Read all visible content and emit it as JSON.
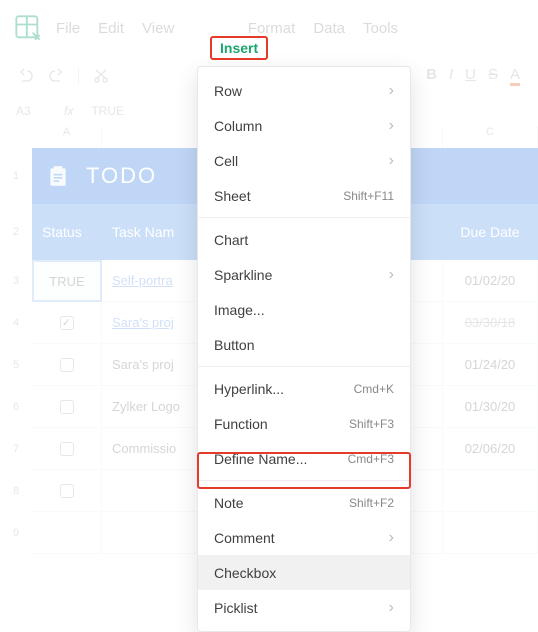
{
  "menubar": {
    "file": "File",
    "edit": "Edit",
    "view": "View",
    "insert": "Insert",
    "format": "Format",
    "data": "Data",
    "tools": "Tools"
  },
  "format_letters": {
    "bold": "B",
    "italic": "I",
    "underline": "U",
    "strike": "S",
    "color": "A"
  },
  "formula_bar": {
    "cell_ref": "A3",
    "fx_label": "fx",
    "value": "TRUE"
  },
  "col_headers": {
    "A": "A",
    "C": "C"
  },
  "rows": {
    "num1": "1",
    "num2": "2",
    "num3": "3",
    "num4": "4",
    "num5": "5",
    "num6": "6",
    "num7": "7",
    "num8": "8",
    "num9": "9"
  },
  "todo": {
    "title": "TODO",
    "header_status": "Status",
    "header_task": "Task Nam",
    "header_due": "Due Date"
  },
  "tasks": {
    "r3_status": "TRUE",
    "r3_name": "Self-portra",
    "r3_due": "01/02/20",
    "r4_name": "Sara's proj",
    "r4_due": "03/30/18",
    "r5_name": "Sara's proj",
    "r5_due": "01/24/20",
    "r6_name": "Zylker Logo",
    "r6_due": "01/30/20",
    "r7_name": "Commissio",
    "r7_due": "02/06/20"
  },
  "dropdown": {
    "row": "Row",
    "column": "Column",
    "cell": "Cell",
    "sheet": "Sheet",
    "sheet_shortcut": "Shift+F11",
    "chart": "Chart",
    "sparkline": "Sparkline",
    "image": "Image...",
    "button": "Button",
    "hyperlink": "Hyperlink...",
    "hyperlink_shortcut": "Cmd+K",
    "function": "Function",
    "function_shortcut": "Shift+F3",
    "define_name": "Define Name...",
    "define_name_shortcut": "Cmd+F3",
    "note": "Note",
    "note_shortcut": "Shift+F2",
    "comment": "Comment",
    "checkbox": "Checkbox",
    "picklist": "Picklist"
  }
}
